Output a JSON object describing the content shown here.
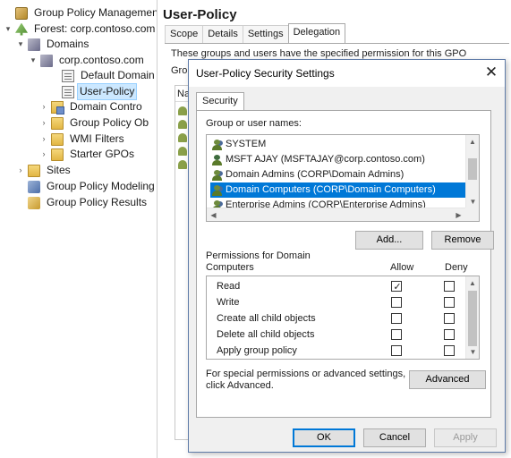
{
  "tree": {
    "items": [
      {
        "label": "Group Policy Management",
        "icon": "gpm-icon",
        "expander": "",
        "name": "tree-item-group-policy-management"
      },
      {
        "label": "Forest: corp.contoso.com",
        "icon": "forest-icon",
        "expander": "▾",
        "name": "tree-item-forest"
      },
      {
        "label": "Domains",
        "icon": "domains-icon",
        "expander": "▾",
        "name": "tree-item-domains"
      },
      {
        "label": "corp.contoso.com",
        "icon": "domain-icon",
        "expander": "▾",
        "name": "tree-item-corp-contoso"
      },
      {
        "label": "Default Domain",
        "icon": "gpo-link-icon",
        "expander": "",
        "name": "tree-item-default-domain"
      },
      {
        "label": "User-Policy",
        "icon": "gpo-link-icon",
        "expander": "",
        "name": "tree-item-user-policy"
      },
      {
        "label": "Domain Contro",
        "icon": "ou-icon",
        "expander": "›",
        "name": "tree-item-domain-controllers"
      },
      {
        "label": "Group Policy Ob",
        "icon": "folder-icon",
        "expander": "›",
        "name": "tree-item-group-policy-objects"
      },
      {
        "label": "WMI Filters",
        "icon": "folder-icon",
        "expander": "›",
        "name": "tree-item-wmi-filters"
      },
      {
        "label": "Starter GPOs",
        "icon": "folder-icon",
        "expander": "›",
        "name": "tree-item-starter-gpos"
      },
      {
        "label": "Sites",
        "icon": "sites-icon",
        "expander": "›",
        "name": "tree-item-sites"
      },
      {
        "label": "Group Policy Modeling",
        "icon": "modeling-icon",
        "expander": "",
        "name": "tree-item-group-policy-modeling"
      },
      {
        "label": "Group Policy Results",
        "icon": "results-icon",
        "expander": "",
        "name": "tree-item-group-policy-results"
      }
    ],
    "selected_label": "User-Policy"
  },
  "panel": {
    "title": "User-Policy",
    "tabs": [
      "Scope",
      "Details",
      "Settings",
      "Delegation"
    ],
    "active_tab": "Delegation",
    "description": "These groups and users have the specified permission for this GPO",
    "group_label_fragment": "Grou",
    "list_header_fragment": "Na"
  },
  "dialog": {
    "title": "User-Policy Security Settings",
    "close_glyph": "✕",
    "tab": "Security",
    "group_label": "Group or user names:",
    "principals": [
      {
        "text": "SYSTEM",
        "icon": "group-icon",
        "selected": false
      },
      {
        "text": "MSFT AJAY (MSFTAJAY@corp.contoso.com)",
        "icon": "user-icon",
        "selected": false
      },
      {
        "text": "Domain Admins (CORP\\Domain Admins)",
        "icon": "group-icon",
        "selected": false
      },
      {
        "text": "Domain Computers (CORP\\Domain Computers)",
        "icon": "group-icon",
        "selected": true
      },
      {
        "text": "Enterprise Admins (CORP\\Enterprise Admins)",
        "icon": "group-icon",
        "selected": false
      }
    ],
    "add_label": "Add...",
    "remove_label": "Remove",
    "permissions_label_line1": "Permissions for Domain",
    "permissions_label_line2": "Computers",
    "allow_label": "Allow",
    "deny_label": "Deny",
    "permissions": [
      {
        "name": "Read",
        "allow": true,
        "deny": false
      },
      {
        "name": "Write",
        "allow": false,
        "deny": false
      },
      {
        "name": "Create all child objects",
        "allow": false,
        "deny": false
      },
      {
        "name": "Delete all child objects",
        "allow": false,
        "deny": false
      },
      {
        "name": "Apply group policy",
        "allow": false,
        "deny": false
      }
    ],
    "special_line1": "For special permissions or advanced settings,",
    "special_line2": "click Advanced.",
    "advanced_label": "Advanced",
    "ok_label": "OK",
    "cancel_label": "Cancel",
    "apply_label": "Apply",
    "accent_color": "#0078d7"
  }
}
